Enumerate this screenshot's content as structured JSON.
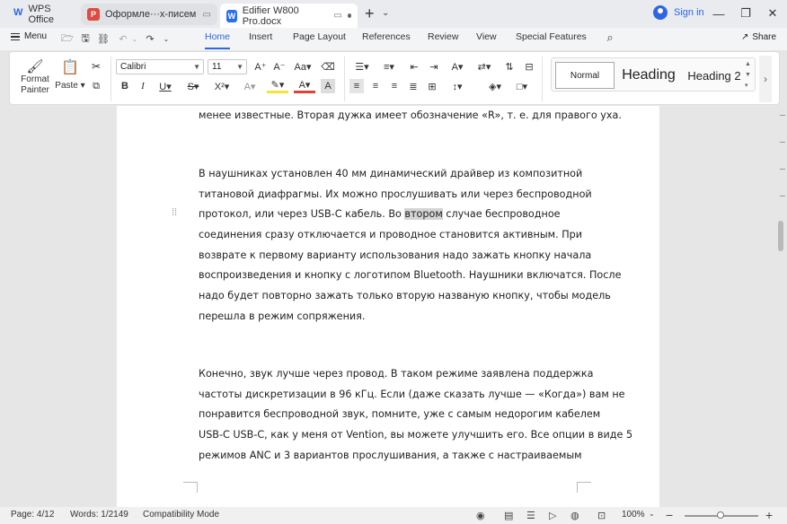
{
  "tabs": [
    {
      "label": "WPS Office"
    },
    {
      "label": "Оформле···х-писем"
    },
    {
      "label": "Edifier W800 Pro.docx"
    }
  ],
  "account": {
    "signin": "Sign in"
  },
  "menubar": {
    "menu_label": "Menu",
    "tabs": [
      "Home",
      "Insert",
      "Page Layout",
      "References",
      "Review",
      "View",
      "Special Features"
    ],
    "active_tab": "Home",
    "share": "Share"
  },
  "ribbon": {
    "format_painter": "Format\nPainter",
    "paste": "Paste",
    "font_name": "Calibri",
    "font_size": "11",
    "styles": [
      "Normal",
      "Heading",
      "Heading 2"
    ]
  },
  "document": {
    "line_top": "менее известные. Вторая дужка имеет обозначение «R», т. е. для правого уха.",
    "para1": [
      "В наушниках установлен 40 мм динамический драйвер из композитной",
      "титановой диафрагмы. Их можно прослушивать или через беспроводной",
      "протокол, или через USB-C кабель. Во ",
      "втором",
      " случае беспроводное",
      "соединения сразу отключается и проводное становится активным. При",
      "возврате к первому варианту использования надо зажать кнопку начала",
      "воспроизведения и кнопку с логотипом Bluetooth. Наушники включатся. После",
      "надо будет повторно зажать только вторую названую кнопку, чтобы модель",
      "перешла в режим сопряжения."
    ],
    "para2": [
      "Конечно, звук лучше через провод. В таком режиме заявлена поддержка",
      "частоты дискретизации в 96 кГц. Если (даже сказать лучше — «Когда») вам не",
      "понравится беспроводной звук, помните, уже с самым недорогим кабелем",
      "USB-C USB-C, как у меня от Vention, вы можете улучшить его. Все опции в виде 5",
      "режимов ANC и 3 вариантов прослушивания, а также с настраиваемым"
    ]
  },
  "status": {
    "page": "Page: 4/12",
    "words": "Words: 1/2149",
    "mode": "Compatibility Mode",
    "zoom": "100%"
  }
}
